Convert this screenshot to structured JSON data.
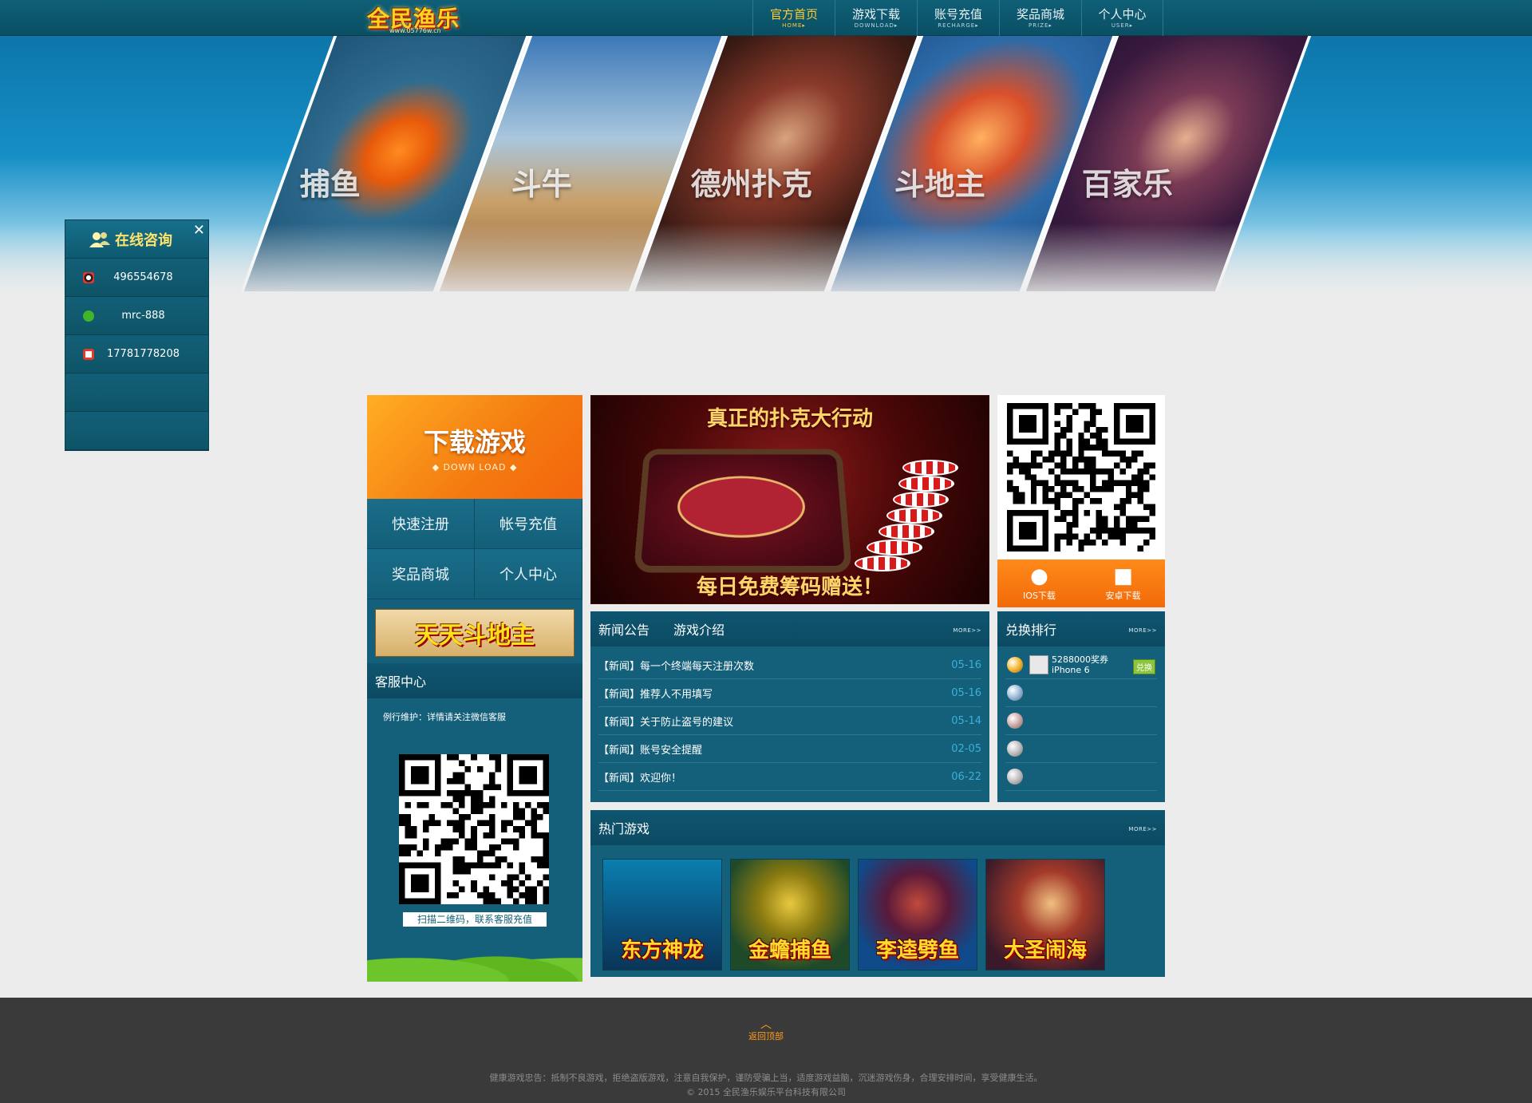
{
  "header": {
    "logo_text": "全民渔乐",
    "logo_url": "www.05776w.cn",
    "nav": [
      {
        "cn": "官方首页",
        "en": "HOME▸",
        "active": true
      },
      {
        "cn": "游戏下载",
        "en": "DOWNLOAD▸",
        "active": false
      },
      {
        "cn": "账号充值",
        "en": "RECHARGE▸",
        "active": false
      },
      {
        "cn": "奖品商城",
        "en": "PRIZE▸",
        "active": false
      },
      {
        "cn": "个人中心",
        "en": "USER▸",
        "active": false
      }
    ]
  },
  "hero": {
    "games": [
      "捕鱼",
      "斗牛",
      "德州扑克",
      "斗地主",
      "百家乐"
    ]
  },
  "consult": {
    "title": "在线咨询",
    "close": "✕",
    "rows": [
      {
        "icon": "qq-icon",
        "value": "496554678"
      },
      {
        "icon": "wechat-icon",
        "value": "mrc-888"
      },
      {
        "icon": "phone-icon",
        "value": "17781778208"
      },
      {
        "icon": "",
        "value": ""
      },
      {
        "icon": "",
        "value": ""
      }
    ]
  },
  "left": {
    "download_title": "下载游戏",
    "download_sub": "◆ DOWN LOAD ◆",
    "quick": [
      "快速注册",
      "帐号充值",
      "奖品商城",
      "个人中心"
    ],
    "ddz_banner": "天天斗地主",
    "service_title": "客服中心",
    "service_note": "例行维护：详情请关注微信客服",
    "service_caption": "扫描二维码，联系客服充值"
  },
  "poker": {
    "top": "真正的扑克大行动",
    "bottom": "每日免费筹码赠送！"
  },
  "app": {
    "ios": "IOS下载",
    "android": "安卓下载"
  },
  "news": {
    "tabs": [
      "新闻公告",
      "游戏介绍"
    ],
    "more": "MORE>>",
    "items": [
      {
        "title": "【新闻】每一个终端每天注册次数",
        "date": "05-16"
      },
      {
        "title": "【新闻】推荐人不用填写",
        "date": "05-16"
      },
      {
        "title": "【新闻】关于防止盗号的建议",
        "date": "05-14"
      },
      {
        "title": "【新闻】账号安全提醒",
        "date": "02-05"
      },
      {
        "title": "【新闻】欢迎你！",
        "date": "06-22"
      }
    ]
  },
  "rank": {
    "title": "兑换排行",
    "more": "MORE>>",
    "first_line1": "5288000奖券",
    "first_line2": "iPhone 6",
    "exchange": "兑换",
    "medal_colors": [
      "#f2b01e",
      "#8fb3d6",
      "#c9a0a0",
      "#b7b7b7",
      "#b7b7b7"
    ]
  },
  "hot": {
    "title": "热门游戏",
    "more": "MORE>>",
    "games": [
      "东方神龙",
      "金蟾捕鱼",
      "李逵劈鱼",
      "大圣闹海"
    ]
  },
  "footer": {
    "back_top": "返回顶部",
    "advice": "健康游戏忠告：抵制不良游戏，拒绝盗版游戏，注意自我保护，谨防受骗上当，适度游戏益脑，沉迷游戏伤身，合理安排时间，享受健康生活。",
    "copyright": "© 2015 全民渔乐娱乐平台科技有限公司"
  }
}
